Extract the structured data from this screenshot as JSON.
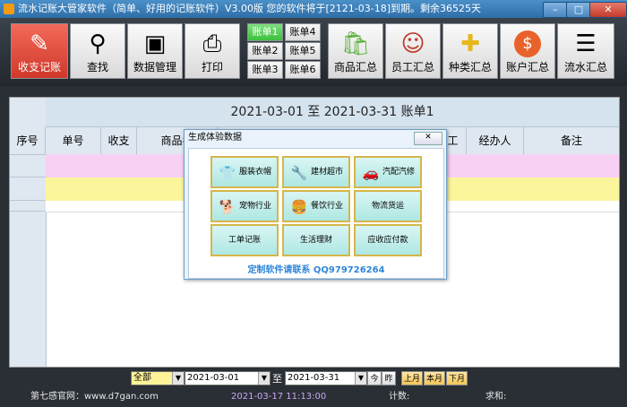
{
  "window": {
    "title": "流水记账大管家软件（简单、好用的记账软件）V3.00版 您的软件将于[2121-03-18]到期。剩余36525天",
    "controls": [
      "minimize-icon",
      "maximize-icon",
      "close-icon"
    ]
  },
  "toolbar": {
    "buttons": [
      {
        "label": "收支记账",
        "icon": "pencil-icon"
      },
      {
        "label": "查找",
        "icon": "binoculars-icon"
      },
      {
        "label": "数据管理",
        "icon": "usb-drive-icon"
      },
      {
        "label": "打印",
        "icon": "printer-icon"
      }
    ],
    "accounts": [
      "账单1",
      "账单4",
      "账单2",
      "账单5",
      "账单3",
      "账单6"
    ],
    "summaries": [
      {
        "label": "商品汇总",
        "icon": "shopify-bag-icon"
      },
      {
        "label": "员工汇总",
        "icon": "employee-icon"
      },
      {
        "label": "种类汇总",
        "icon": "puzzle-icon"
      },
      {
        "label": "账户汇总",
        "icon": "dollar-coin-icon"
      },
      {
        "label": "流水汇总",
        "icon": "list-icon"
      }
    ]
  },
  "bill": {
    "title": "2021-03-01  至  2021-03-31  账单1",
    "columns": [
      "序号",
      "单号",
      "收支",
      "商品名",
      "工",
      "经办人",
      "备注"
    ]
  },
  "dialog": {
    "title": "生成体验数据",
    "industries": [
      {
        "label": "服装衣帽",
        "icon": "tshirt-icon"
      },
      {
        "label": "建材超市",
        "icon": "screwdriver-icon"
      },
      {
        "label": "汽配汽修",
        "icon": "car-icon"
      },
      {
        "label": "宠物行业",
        "icon": "dog-icon"
      },
      {
        "label": "餐饮行业",
        "icon": "burger-icon"
      },
      {
        "label": "物流货运",
        "icon": ""
      },
      {
        "label": "工单记账",
        "icon": ""
      },
      {
        "label": "生活理财",
        "icon": ""
      },
      {
        "label": "应收应付款",
        "icon": ""
      }
    ],
    "footer": "定制软件请联系  QQ979726264"
  },
  "filter": {
    "category": "全部",
    "start_date": "2021-03-01",
    "to_label": "至",
    "end_date": "2021-03-31",
    "today": "今",
    "yesterday": "昨",
    "this_month": "上月",
    "current_month": "本月",
    "next_month": "下月"
  },
  "status": {
    "site": "第七感官网：www.d7gan.com",
    "datetime": "2021-03-17 11:13:00",
    "count_label": "计数:",
    "sum_label": "求和:"
  },
  "colors": {
    "row_pink": "#f7d0f4",
    "row_yellow": "#fbf59c",
    "active_red": "#e04a3a",
    "account_green": "#3cbf3c",
    "accent_blue": "#2f86d9"
  }
}
